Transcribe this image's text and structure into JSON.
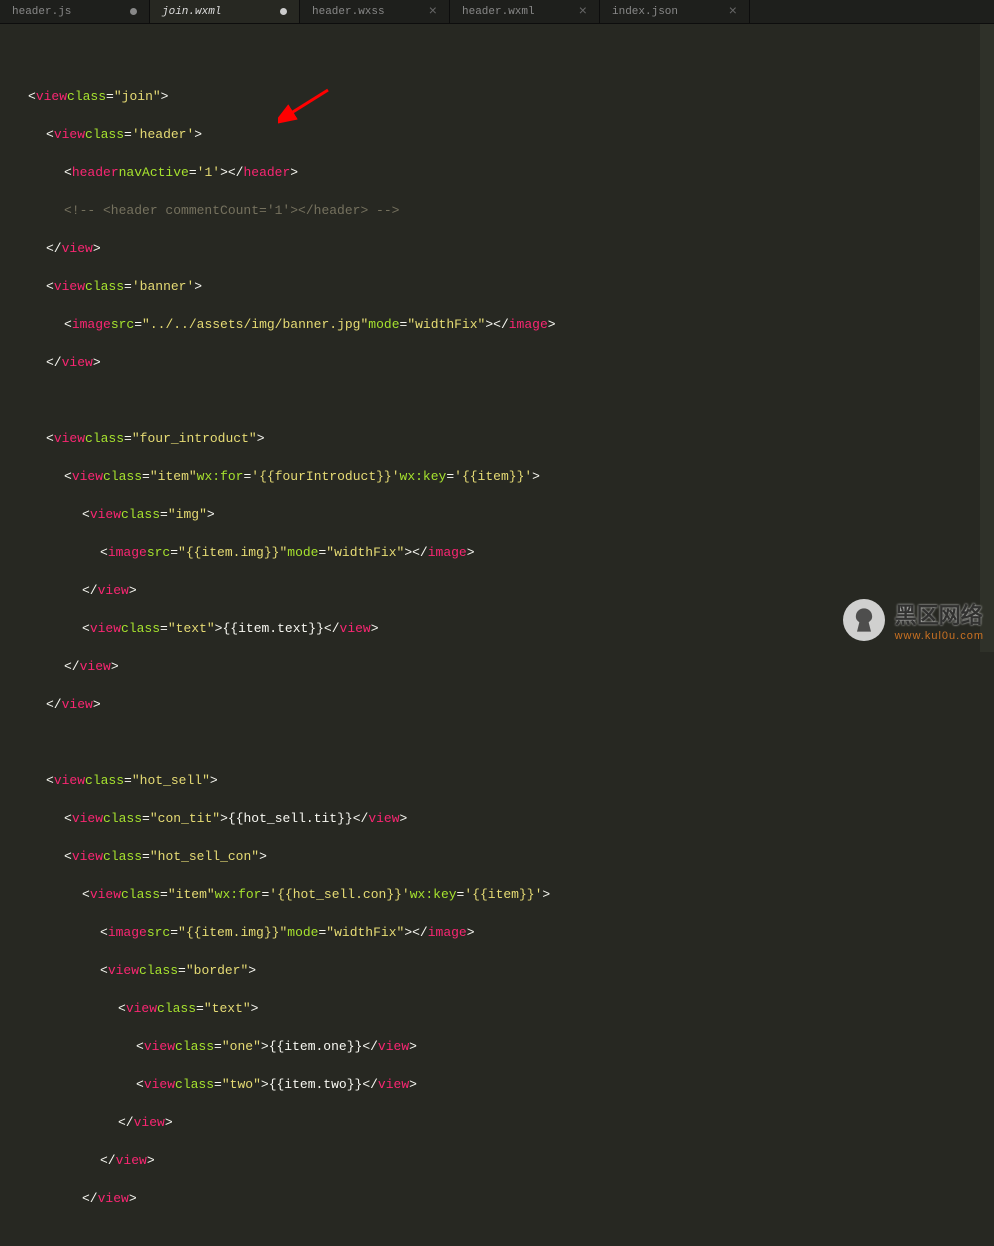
{
  "tabs": [
    {
      "label": "header.js",
      "active": false
    },
    {
      "label": "join.wxml",
      "active": true
    },
    {
      "label": "header.wxss",
      "active": false
    },
    {
      "label": "header.wxml",
      "active": false
    },
    {
      "label": "index.json",
      "active": false
    }
  ],
  "watermark": {
    "text": "黑区网络",
    "url": "www.kul0u.com"
  },
  "code": {
    "l1": {
      "tag": "view",
      "attr": "class",
      "val": "\"join\""
    },
    "l2": {
      "tag": "view",
      "attr": "class",
      "val": "'header'"
    },
    "l3": {
      "tag": "header",
      "attr": "navActive",
      "val": "'1'",
      "close": "header"
    },
    "l4": {
      "comment": "<!-- <header commentCount='1'></header> -->"
    },
    "l5": {
      "close": "view"
    },
    "l6": {
      "tag": "view",
      "attr": "class",
      "val": "'banner'"
    },
    "l7": {
      "tag": "image",
      "attr1": "src",
      "val1": "\"../../assets/img/banner.jpg\"",
      "attr2": "mode",
      "val2": "\"widthFix\"",
      "close": "image"
    },
    "l8": {
      "close": "view"
    },
    "l9": {
      "tag": "view",
      "attr": "class",
      "val": "\"four_introduct\""
    },
    "l10": {
      "tag": "view",
      "attr1": "class",
      "val1": "\"item\"",
      "attr2": "wx:for",
      "val2": "'{{fourIntroduct}}'",
      "attr3": "wx:key",
      "val3": "'{{item}}'"
    },
    "l11": {
      "tag": "view",
      "attr": "class",
      "val": "\"img\""
    },
    "l12": {
      "tag": "image",
      "attr1": "src",
      "val1": "\"{{item.img}}\"",
      "attr2": "mode",
      "val2": "\"widthFix\"",
      "close": "image"
    },
    "l13": {
      "close": "view"
    },
    "l14": {
      "tag": "view",
      "attr": "class",
      "val": "\"text\"",
      "text": "{{item.text}}",
      "close": "view"
    },
    "l15": {
      "close": "view"
    },
    "l16": {
      "close": "view"
    },
    "l17": {
      "tag": "view",
      "attr": "class",
      "val": "\"hot_sell\""
    },
    "l18": {
      "tag": "view",
      "attr": "class",
      "val": "\"con_tit\"",
      "text": "{{hot_sell.tit}}",
      "close": "view"
    },
    "l19": {
      "tag": "view",
      "attr": "class",
      "val": "\"hot_sell_con\""
    },
    "l20": {
      "tag": "view",
      "attr1": "class",
      "val1": "\"item\"",
      "attr2": "wx:for",
      "val2": "'{{hot_sell.con}}'",
      "attr3": "wx:key",
      "val3": "'{{item}}'"
    },
    "l21": {
      "tag": "image",
      "attr1": "src",
      "val1": "\"{{item.img}}\"",
      "attr2": "mode",
      "val2": "\"widthFix\"",
      "close": "image"
    },
    "l22": {
      "tag": "view",
      "attr": "class",
      "val": "\"border\""
    },
    "l23": {
      "tag": "view",
      "attr": "class",
      "val": "\"text\""
    },
    "l24": {
      "tag": "view",
      "attr": "class",
      "val": "\"one\"",
      "text": "{{item.one}}",
      "close": "view"
    },
    "l25": {
      "tag": "view",
      "attr": "class",
      "val": "\"two\"",
      "text": "{{item.two}}",
      "close": "view"
    },
    "l26": {
      "close": "view"
    },
    "l27": {
      "close": "view"
    },
    "l28": {
      "close": "view"
    }
  }
}
